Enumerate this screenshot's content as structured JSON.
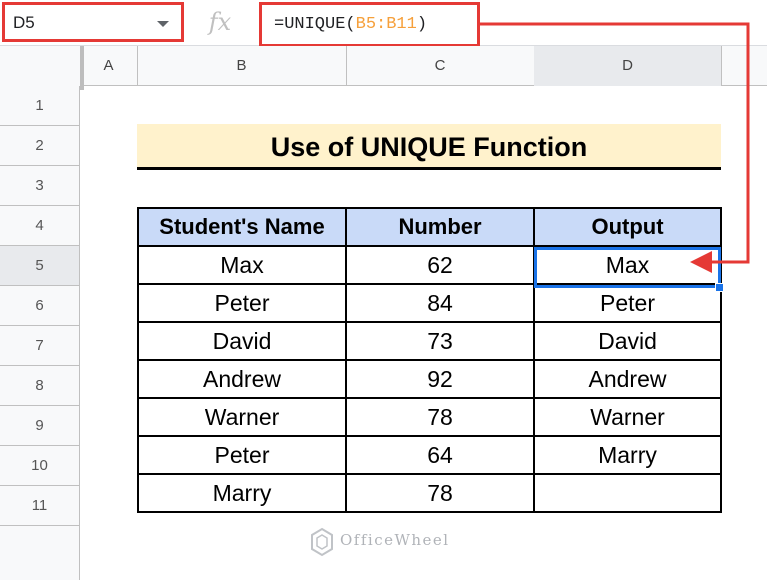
{
  "formula_bar": {
    "cell_reference": "D5",
    "fx_label": "fx",
    "formula_prefix": "=UNIQUE(",
    "formula_range": "B5:B11",
    "formula_suffix": ")"
  },
  "columns": [
    "A",
    "B",
    "C",
    "D"
  ],
  "rows": [
    "1",
    "2",
    "3",
    "4",
    "5",
    "6",
    "7",
    "8",
    "9",
    "10",
    "11"
  ],
  "selected_row": "5",
  "title": "Use of UNIQUE Function",
  "table": {
    "headers": [
      "Student's Name",
      "Number",
      "Output"
    ],
    "rows": [
      [
        "Max",
        "62",
        "Max"
      ],
      [
        "Peter",
        "84",
        "Peter"
      ],
      [
        "David",
        "73",
        "David"
      ],
      [
        "Andrew",
        "92",
        "Andrew"
      ],
      [
        "Warner",
        "78",
        "Warner"
      ],
      [
        "Peter",
        "64",
        "Marry"
      ],
      [
        "Marry",
        "78",
        ""
      ]
    ]
  },
  "watermark": "OfficeWheel",
  "colors": {
    "highlight": "#e53935",
    "selection": "#1a73e8",
    "title_bg": "#fff2cc",
    "header_bg": "#c9daf8",
    "range_ref": "#f6a03b"
  }
}
